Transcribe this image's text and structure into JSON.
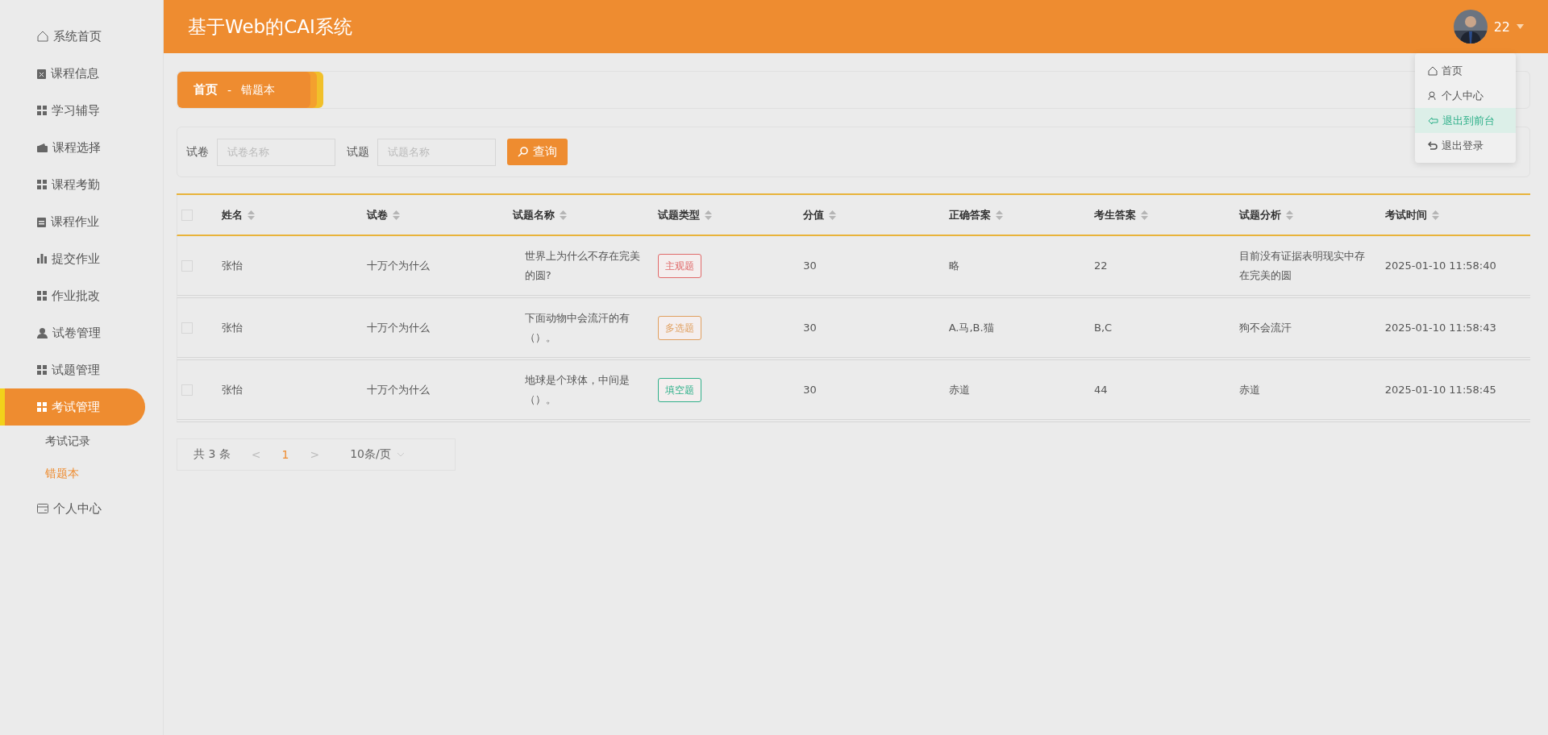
{
  "header": {
    "title": "基于Web的CAI系统",
    "user": "22"
  },
  "user_menu": [
    {
      "label": "首页",
      "selected": false
    },
    {
      "label": "个人中心",
      "selected": false
    },
    {
      "label": "退出到前台",
      "selected": true
    },
    {
      "label": "退出登录",
      "selected": false
    }
  ],
  "sidebar": {
    "items": [
      {
        "label": "系统首页",
        "selected": false
      },
      {
        "label": "课程信息",
        "selected": false
      },
      {
        "label": "学习辅导",
        "selected": false
      },
      {
        "label": "课程选择",
        "selected": false
      },
      {
        "label": "课程考勤",
        "selected": false
      },
      {
        "label": "课程作业",
        "selected": false
      },
      {
        "label": "提交作业",
        "selected": false
      },
      {
        "label": "作业批改",
        "selected": false
      },
      {
        "label": "试卷管理",
        "selected": false
      },
      {
        "label": "试题管理",
        "selected": false
      },
      {
        "label": "考试管理",
        "selected": true,
        "children": [
          {
            "label": "考试记录",
            "selected": false
          },
          {
            "label": "错题本",
            "selected": true
          }
        ]
      },
      {
        "label": "个人中心",
        "selected": false
      }
    ]
  },
  "breadcrumb": {
    "home": "首页",
    "separator": "-",
    "current": "错题本"
  },
  "search": {
    "fields": [
      {
        "label": "试卷",
        "placeholder": "试卷名称"
      },
      {
        "label": "试题",
        "placeholder": "试题名称"
      }
    ],
    "button": "查询"
  },
  "table": {
    "all_checked": false,
    "columns": [
      "姓名",
      "试卷",
      "试题名称",
      "试题类型",
      "分值",
      "正确答案",
      "考生答案",
      "试题分析",
      "考试时间"
    ],
    "rows": [
      {
        "checked": false,
        "cells": [
          "张怡",
          "十万个为什么",
          "世界上为什么不存在完美的圆?",
          {
            "tag": "主观题",
            "color": "#e06a6a"
          },
          "30",
          "略",
          "22",
          "目前没有证据表明现实中存在完美的圆",
          "2025-01-10 11:58:40"
        ]
      },
      {
        "checked": false,
        "cells": [
          "张怡",
          "十万个为什么",
          "下面动物中会流汗的有（）。",
          {
            "tag": "多选题",
            "color": "#e0a060"
          },
          "30",
          "A.马,B.猫",
          "B,C",
          "狗不会流汗",
          "2025-01-10 11:58:43"
        ]
      },
      {
        "checked": false,
        "cells": [
          "张怡",
          "十万个为什么",
          "地球是个球体，中间是（）。",
          {
            "tag": "填空题",
            "color": "#2fb08a"
          },
          "30",
          "赤道",
          "44",
          "赤道",
          "2025-01-10 11:58:45"
        ]
      }
    ]
  },
  "pagination": {
    "total": "共 3 条",
    "prev": "<",
    "pages": [
      {
        "label": "1",
        "selected": true
      }
    ],
    "next": ">",
    "page_size": "10条/页"
  }
}
